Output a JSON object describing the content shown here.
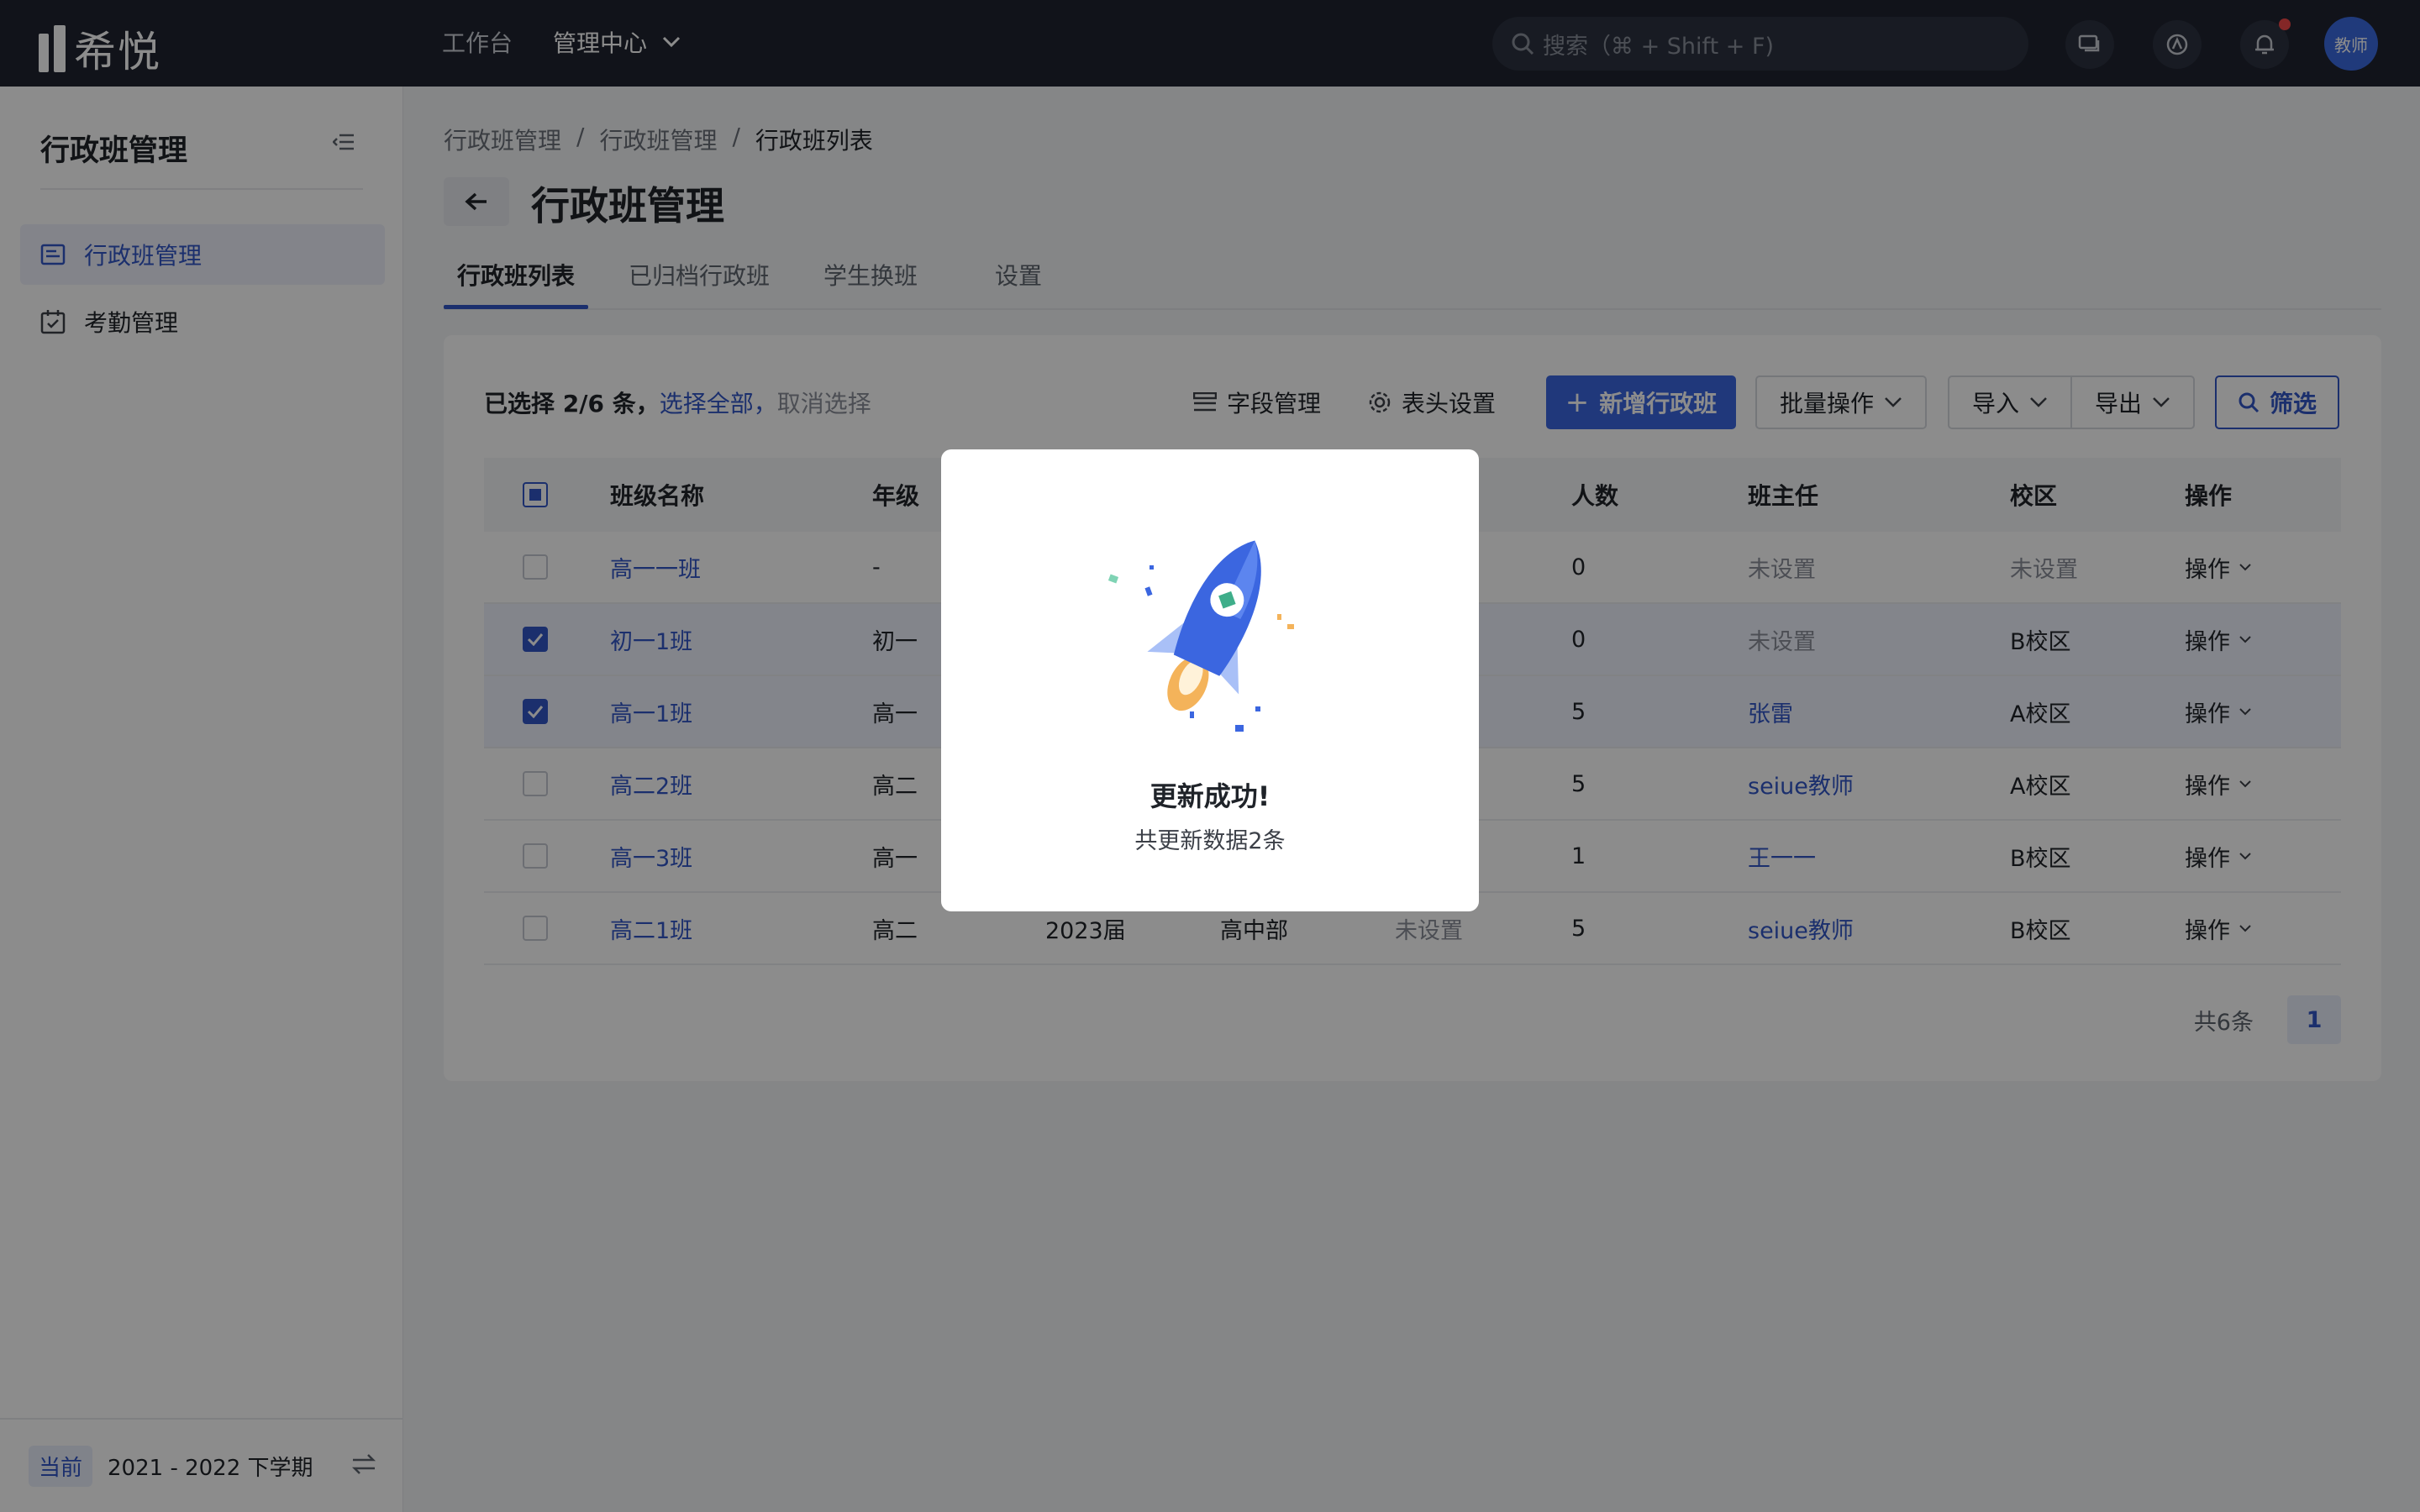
{
  "app": {
    "logo_text": "希悦"
  },
  "topnav": {
    "workbench": "工作台",
    "admin_center": "管理中心"
  },
  "search": {
    "placeholder": "搜索（⌘ + Shift + F)"
  },
  "user": {
    "avatar_text": "教师"
  },
  "sidebar": {
    "title": "行政班管理",
    "items": [
      {
        "label": "行政班管理",
        "icon": "class-list-icon",
        "active": true
      },
      {
        "label": "考勤管理",
        "icon": "calendar-check-icon",
        "active": false
      }
    ],
    "term_badge": "当前",
    "term_text": "2021 - 2022 下学期"
  },
  "breadcrumb": [
    "行政班管理",
    "/",
    "行政班管理",
    "/",
    "行政班列表"
  ],
  "page_title": "行政班管理",
  "tabs": [
    "行政班列表",
    "已归档行政班",
    "学生换班",
    "设置"
  ],
  "toolbar": {
    "selected_text": "已选择 2/6 条，",
    "select_all": "选择全部，",
    "clear_selection": "取消选择",
    "field_manage": "字段管理",
    "header_settings": "表头设置",
    "add_class": "新增行政班",
    "batch_ops": "批量操作",
    "import": "导入",
    "export": "导出",
    "filter": "筛选"
  },
  "table": {
    "headers": {
      "name": "班级名称",
      "grade": "年级",
      "count": "人数",
      "teacher": "班主任",
      "campus": "校区",
      "ops": "操作"
    },
    "rows": [
      {
        "name": "高一一班",
        "grade": "-",
        "year": "",
        "dept": "",
        "extra": "",
        "count": "0",
        "teacher": "未设置",
        "campus": "未设置",
        "ops": "操作",
        "checked": false
      },
      {
        "name": "初一1班",
        "grade": "初一",
        "year": "",
        "dept": "",
        "extra": "",
        "count": "0",
        "teacher": "未设置",
        "campus": "B校区",
        "ops": "操作",
        "checked": true
      },
      {
        "name": "高一1班",
        "grade": "高一",
        "year": "",
        "dept": "",
        "extra": "",
        "count": "5",
        "teacher": "张雷",
        "campus": "A校区",
        "ops": "操作",
        "checked": true
      },
      {
        "name": "高二2班",
        "grade": "高二",
        "year": "",
        "dept": "",
        "extra": "",
        "count": "5",
        "teacher": "seiue教师",
        "campus": "A校区",
        "ops": "操作",
        "checked": false
      },
      {
        "name": "高一3班",
        "grade": "高一",
        "year": "",
        "dept": "",
        "extra": "",
        "count": "1",
        "teacher": "王一一",
        "campus": "B校区",
        "ops": "操作",
        "checked": false
      },
      {
        "name": "高二1班",
        "grade": "高二",
        "year": "2023届",
        "dept": "高中部",
        "extra": "未设置",
        "count": "5",
        "teacher": "seiue教师",
        "campus": "B校区",
        "ops": "操作",
        "checked": false
      }
    ]
  },
  "pagination": {
    "total": "共6条",
    "current": "1"
  },
  "modal": {
    "title": "更新成功!",
    "message": "共更新数据2条"
  }
}
